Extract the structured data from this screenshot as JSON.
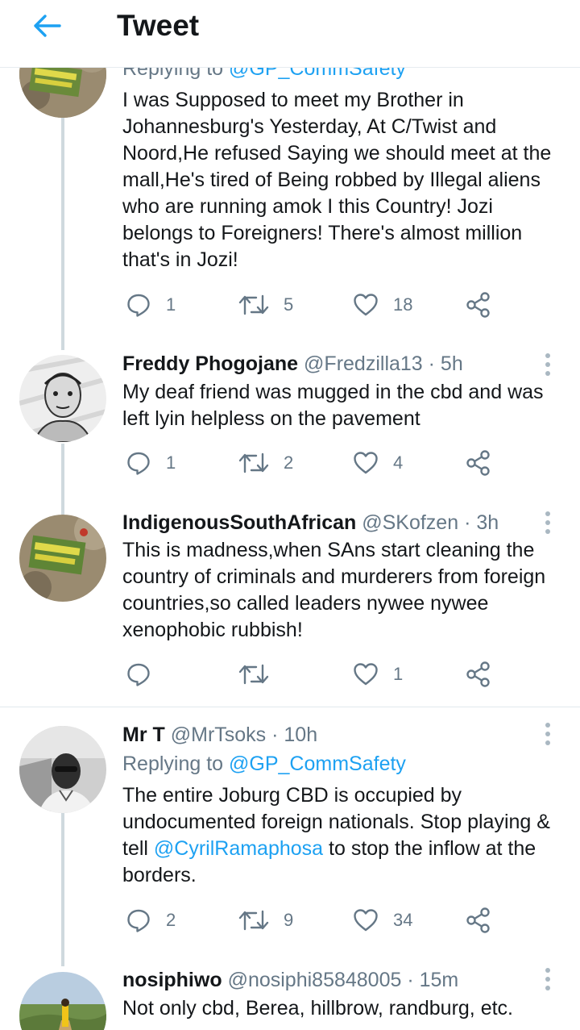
{
  "header": {
    "title": "Tweet"
  },
  "partial": {
    "reply_prefix": "Replying to ",
    "reply_handle": "@GP_CommSafety",
    "text": "I was Supposed to meet my Brother in Johannesburg's Yesterday, At C/Twist and Noord,He refused Saying we should meet at the mall,He's tired of Being robbed by Illegal aliens who are running amok I this Country! Jozi belongs to Foreigners! There's almost million that's in Jozi!",
    "replies": "1",
    "retweets": "5",
    "likes": "18"
  },
  "freddy": {
    "name": "Freddy Phogojane",
    "handle": "@Fredzilla13",
    "sep": " · ",
    "time": "5h",
    "text": "My deaf friend was mugged in the cbd and was left lyin helpless on the pavement",
    "replies": "1",
    "retweets": "2",
    "likes": "4"
  },
  "indigenous": {
    "name": "IndigenousSouthAfrican",
    "handle": "@SKofzen",
    "sep": " · ",
    "time": "3h",
    "text": "This is madness,when SAns start cleaning the country of criminals and murderers from foreign countries,so called leaders nywee nywee xenophobic rubbish!",
    "likes": "1"
  },
  "mrt": {
    "name": "Mr T",
    "handle": "@MrTsoks",
    "sep": " · ",
    "time": "10h",
    "reply_prefix": "Replying to ",
    "reply_handle": "@GP_CommSafety",
    "text_1": "The entire Joburg CBD is occupied by undocumented foreign nationals. Stop playing & tell ",
    "text_mention": "@CyrilRamaphosa",
    "text_2": " to stop the inflow at the borders.",
    "replies": "2",
    "retweets": "9",
    "likes": "34"
  },
  "nosiphiwo": {
    "name": "nosiphiwo",
    "handle": "@nosiphi85848005",
    "sep": " · ",
    "time": "15m",
    "text": "Not only cbd, Berea, hillbrow, randburg, etc."
  },
  "icons": {
    "back": "arrow-left-icon",
    "reply": "speech-bubble-icon",
    "retweet": "retweet-arrows-icon",
    "like": "heart-icon",
    "share": "share-nodes-icon",
    "more": "vertical-dots-icon"
  },
  "colors": {
    "accent": "#1da1f2",
    "secondary_text": "#657786",
    "icon": "#657786",
    "thread_line": "#cfd9de"
  }
}
